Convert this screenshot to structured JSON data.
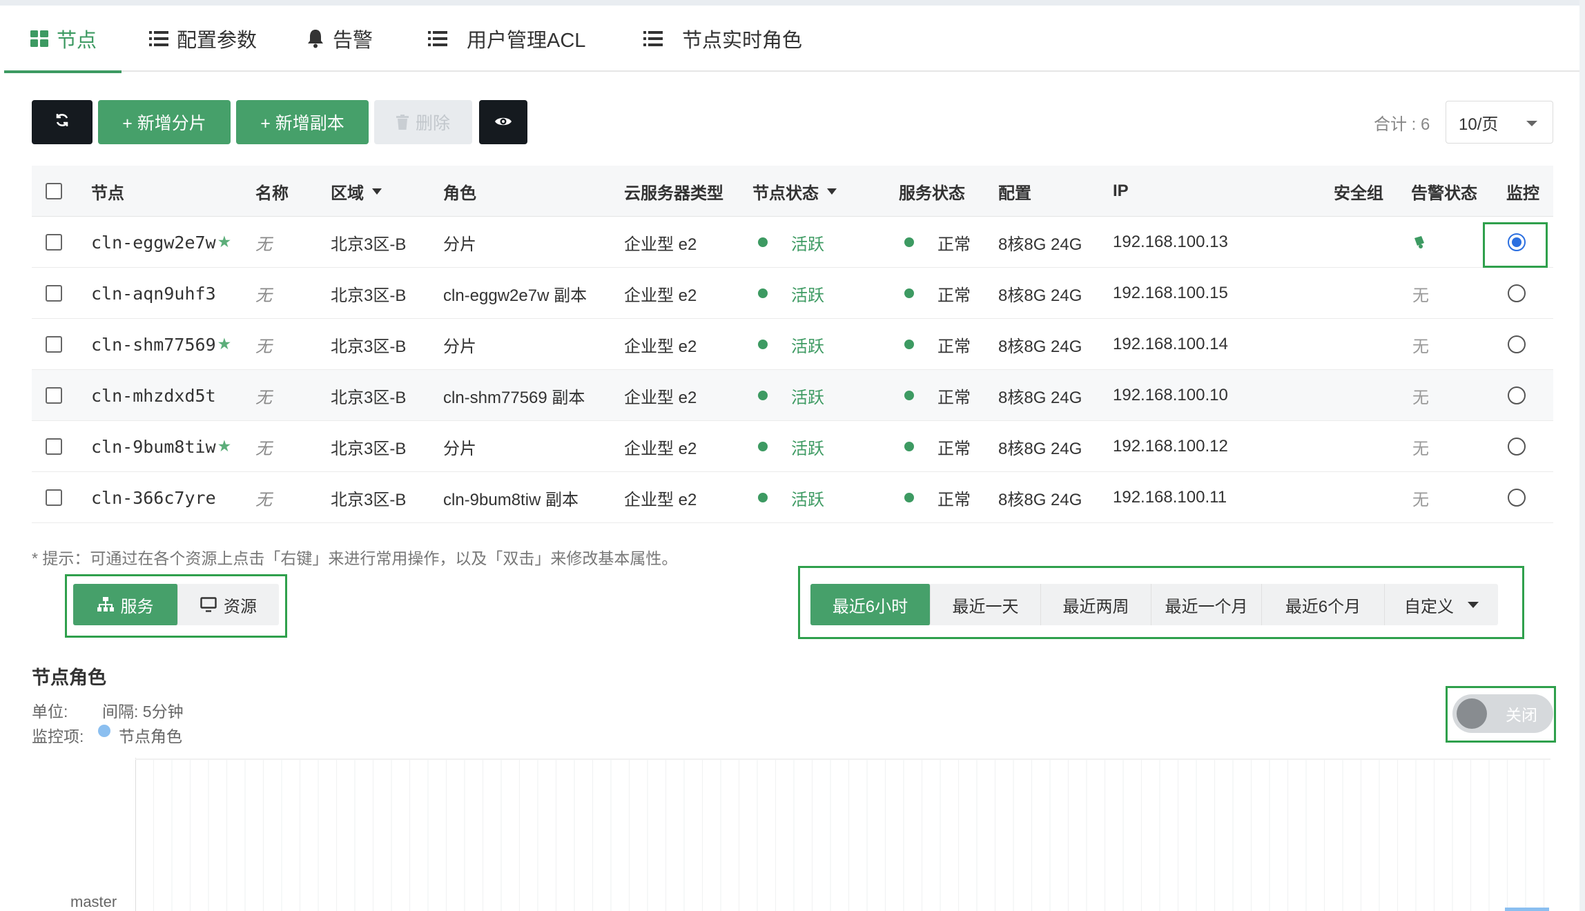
{
  "tabs": [
    {
      "label": "节点",
      "icon": "grid-icon",
      "active": true
    },
    {
      "label": "配置参数",
      "icon": "list-icon",
      "active": false
    },
    {
      "label": "告警",
      "icon": "bell-icon",
      "active": false
    },
    {
      "label": "用户管理ACL",
      "icon": "list-icon",
      "active": false
    },
    {
      "label": "节点实时角色",
      "icon": "list-icon",
      "active": false
    }
  ],
  "toolbar": {
    "refresh_icon": "refresh-icon",
    "add_shard": "+ 新增分片",
    "add_replica": "+ 新增副本",
    "delete": "删除",
    "view_icon": "eye-icon",
    "total": "合计 : 6",
    "page_size": "10/页"
  },
  "table": {
    "headers": [
      "节点",
      "名称",
      "区域",
      "角色",
      "云服务器类型",
      "节点状态",
      "服务状态",
      "配置",
      "IP",
      "安全组",
      "告警状态",
      "监控"
    ],
    "rows": [
      {
        "node": "cln-eggw2e7w",
        "star": "★",
        "name": "无",
        "region": "北京3区-B",
        "role": "分片",
        "type": "企业型 e2",
        "node_status": "活跃",
        "service_status": "正常",
        "config": "8核8G 24G",
        "ip": "192.168.100.13",
        "sg": "",
        "alarm": "",
        "monitor": true
      },
      {
        "node": "cln-aqn9uhf3",
        "star": "",
        "name": "无",
        "region": "北京3区-B",
        "role": "cln-eggw2e7w 副本",
        "type": "企业型 e2",
        "node_status": "活跃",
        "service_status": "正常",
        "config": "8核8G 24G",
        "ip": "192.168.100.15",
        "sg": "",
        "alarm": "无",
        "monitor": false
      },
      {
        "node": "cln-shm77569",
        "star": "★",
        "name": "无",
        "region": "北京3区-B",
        "role": "分片",
        "type": "企业型 e2",
        "node_status": "活跃",
        "service_status": "正常",
        "config": "8核8G 24G",
        "ip": "192.168.100.14",
        "sg": "",
        "alarm": "无",
        "monitor": false
      },
      {
        "node": "cln-mhzdxd5t",
        "star": "",
        "name": "无",
        "region": "北京3区-B",
        "role": "cln-shm77569 副本",
        "type": "企业型 e2",
        "node_status": "活跃",
        "service_status": "正常",
        "config": "8核8G 24G",
        "ip": "192.168.100.10",
        "sg": "",
        "alarm": "无",
        "monitor": false
      },
      {
        "node": "cln-9bum8tiw",
        "star": "★",
        "name": "无",
        "region": "北京3区-B",
        "role": "分片",
        "type": "企业型 e2",
        "node_status": "活跃",
        "service_status": "正常",
        "config": "8核8G 24G",
        "ip": "192.168.100.12",
        "sg": "",
        "alarm": "无",
        "monitor": false
      },
      {
        "node": "cln-366c7yre",
        "star": "",
        "name": "无",
        "region": "北京3区-B",
        "role": "cln-9bum8tiw 副本",
        "type": "企业型 e2",
        "node_status": "活跃",
        "service_status": "正常",
        "config": "8核8G 24G",
        "ip": "192.168.100.11",
        "sg": "",
        "alarm": "无",
        "monitor": false
      }
    ]
  },
  "hint": "* 提示：可通过在各个资源上点击「右键」来进行常用操作，以及「双击」来修改基本属性。",
  "view_switch": {
    "service": "服务",
    "resource": "资源"
  },
  "time_range": {
    "items": [
      "最近6小时",
      "最近一天",
      "最近两周",
      "最近一个月",
      "最近6个月",
      "自定义"
    ],
    "active": 0
  },
  "monitor_section": {
    "title": "节点角色",
    "unit_label": "单位:",
    "interval": "间隔: 5分钟",
    "item_label": "监控项:",
    "item": "节点角色",
    "toggle_label": "关闭",
    "y_label": "master"
  },
  "colors": {
    "accent": "#46a06a",
    "active_text": "#3d9a62",
    "radio": "#2b6fe0",
    "highlight": "#2fa04c",
    "legend": "#8bbff0"
  }
}
